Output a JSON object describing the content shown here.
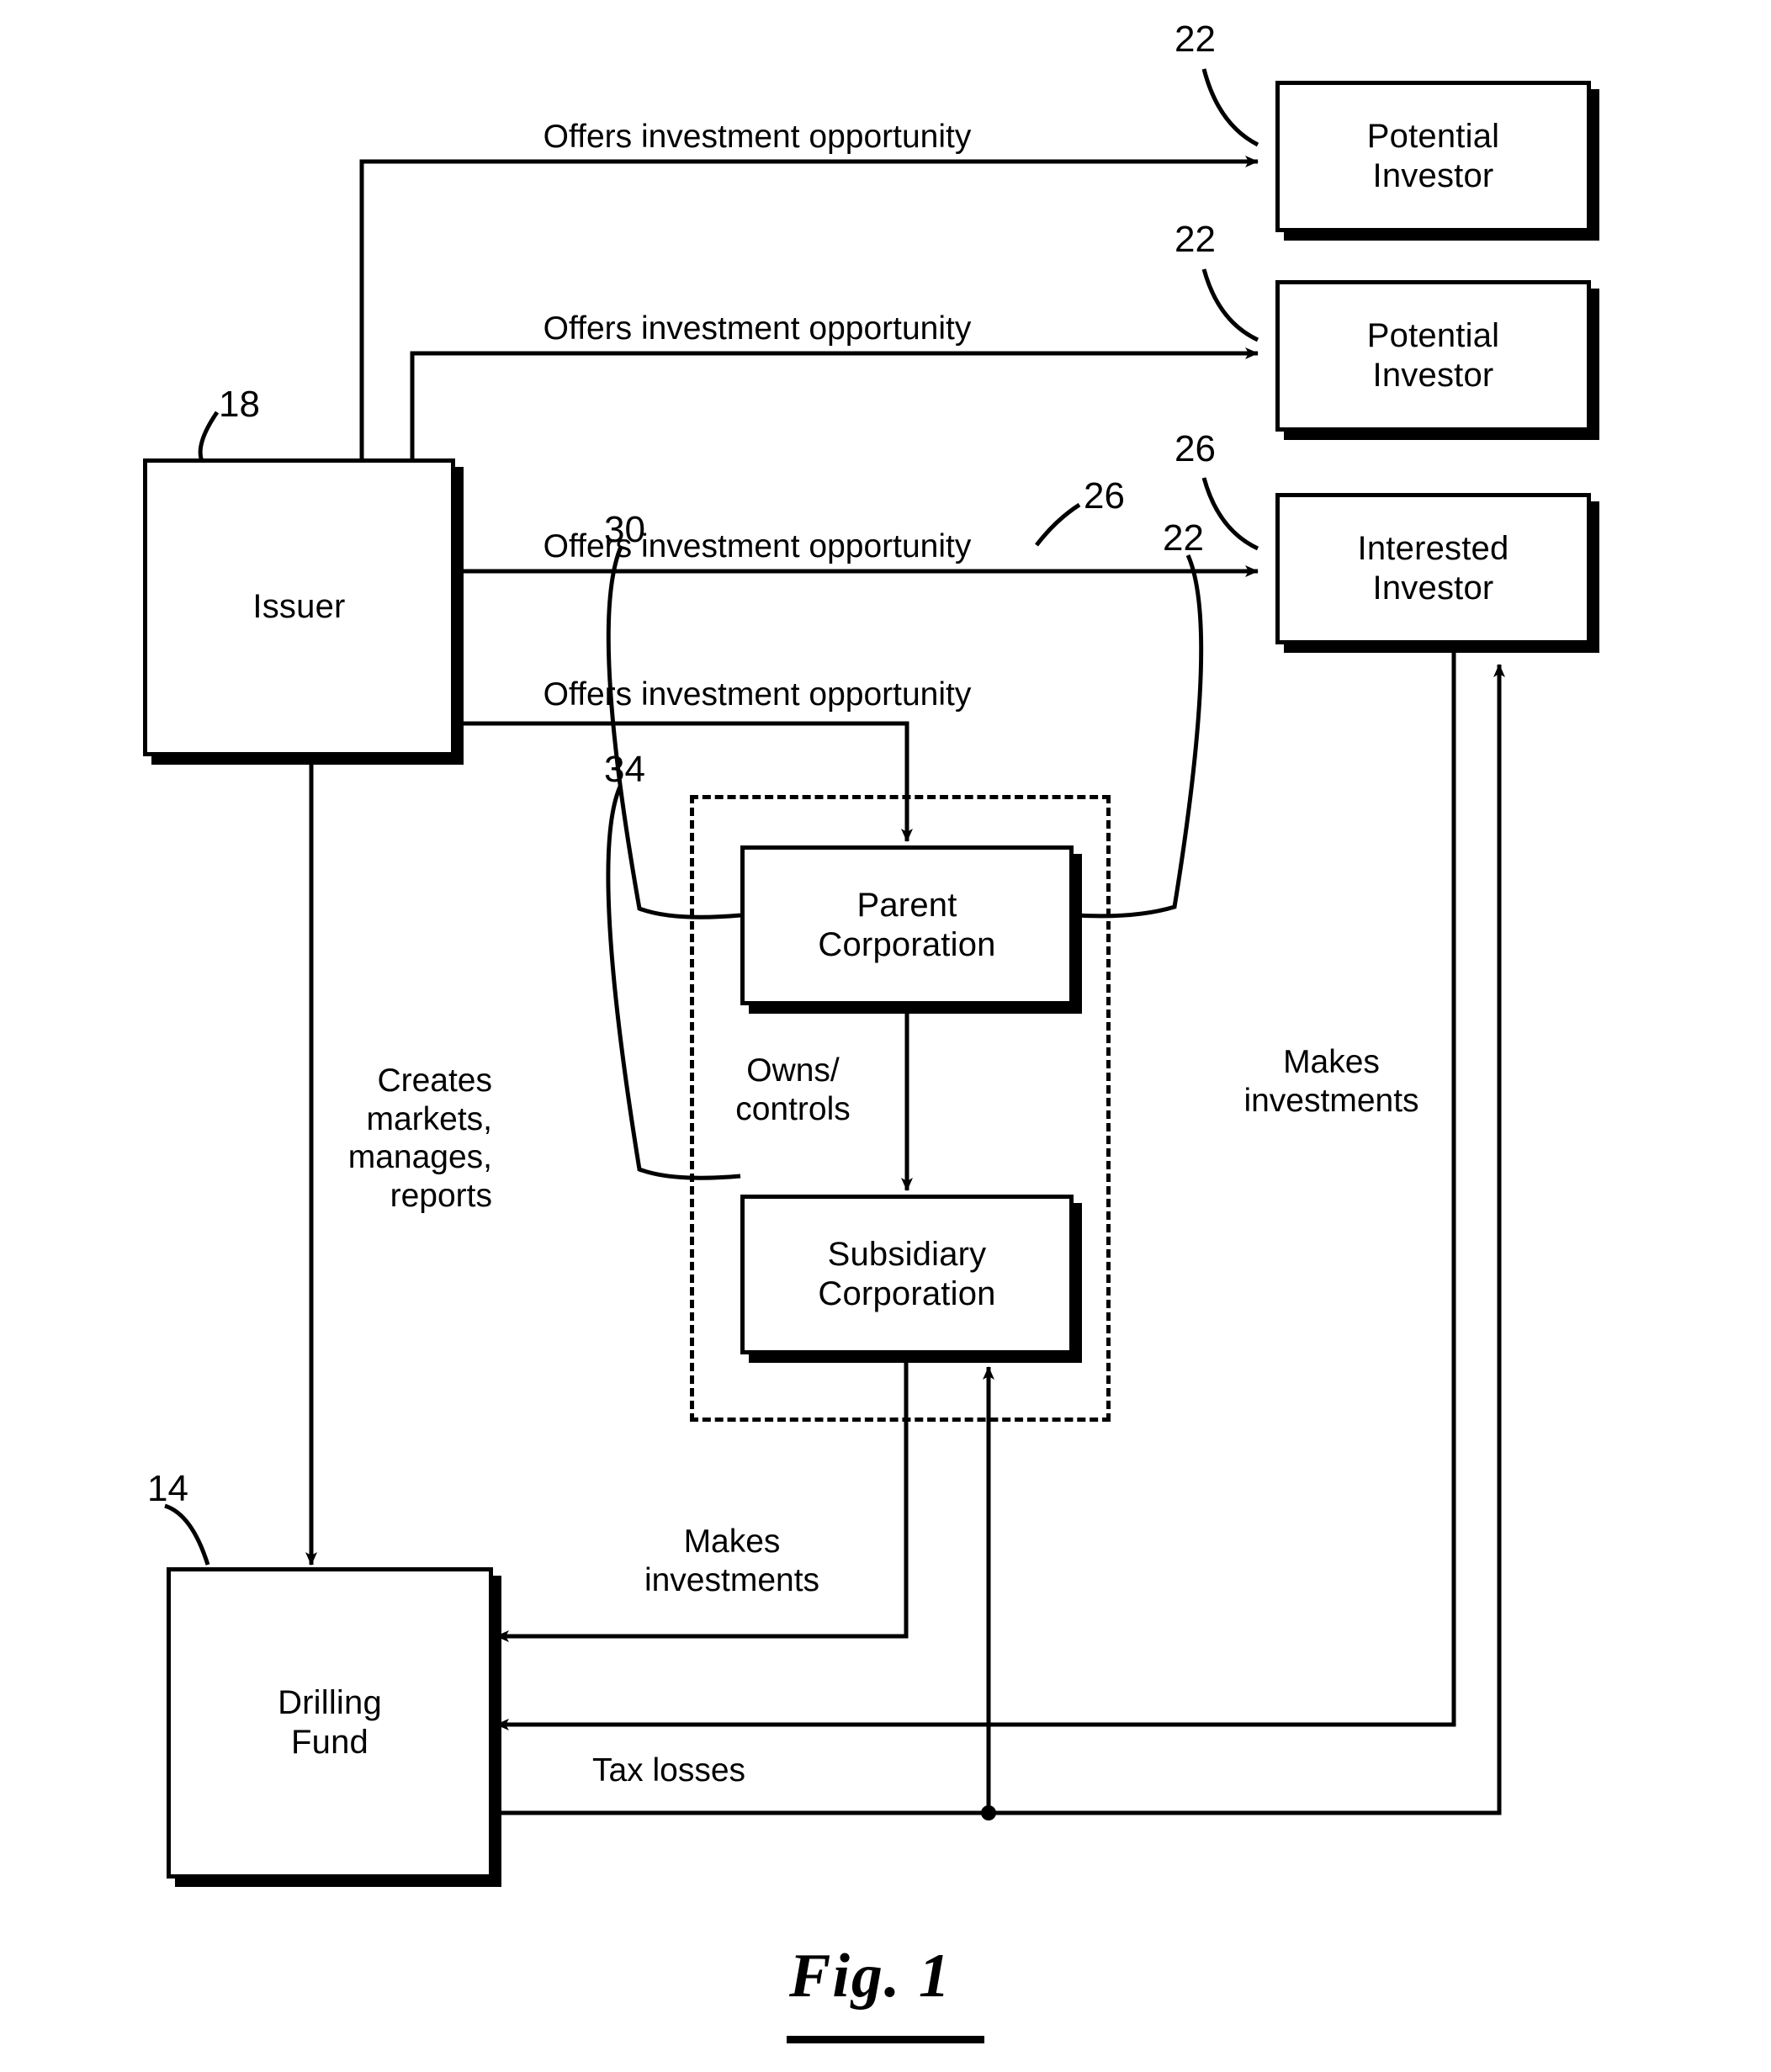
{
  "figure": {
    "caption": "Fig. 1",
    "type": "patent-flow-diagram"
  },
  "nodes": {
    "issuer": {
      "label": "Issuer",
      "ref": "18"
    },
    "potential_investor_1": {
      "label": "Potential\nInvestor",
      "ref": "22"
    },
    "potential_investor_2": {
      "label": "Potential\nInvestor",
      "ref": "22"
    },
    "interested_investor": {
      "label": "Interested\nInvestor",
      "ref": "26"
    },
    "parent_corporation": {
      "label": "Parent\nCorporation",
      "ref_left": "30",
      "ref_right": "22"
    },
    "subsidiary_corporation": {
      "label": "Subsidiary\nCorporation",
      "ref": "34"
    },
    "drilling_fund": {
      "label": "Drilling\nFund",
      "ref": "14"
    }
  },
  "group": {
    "label_ref": "26",
    "style": "dashed-boundary"
  },
  "edges": [
    {
      "id": "e1",
      "from": "issuer",
      "to": "potential_investor_1",
      "label": "Offers investment opportunity"
    },
    {
      "id": "e2",
      "from": "issuer",
      "to": "potential_investor_2",
      "label": "Offers investment opportunity"
    },
    {
      "id": "e3",
      "from": "issuer",
      "to": "interested_investor",
      "label": "Offers investment opportunity"
    },
    {
      "id": "e4",
      "from": "issuer",
      "to": "parent_corporation",
      "label": "Offers investment opportunity"
    },
    {
      "id": "e5",
      "from": "issuer",
      "to": "drilling_fund",
      "label": "Creates\nmarkets,\nmanages,\nreports"
    },
    {
      "id": "e6",
      "from": "parent_corporation",
      "to": "subsidiary_corporation",
      "label": "Owns/\ncontrols"
    },
    {
      "id": "e7",
      "from": "subsidiary_corporation",
      "to": "drilling_fund",
      "label": "Makes\ninvestments"
    },
    {
      "id": "e8",
      "from": "interested_investor",
      "to": "drilling_fund",
      "label": "Makes\ninvestments"
    },
    {
      "id": "e9",
      "from": "drilling_fund",
      "to": "interested_investor",
      "label": "Tax losses"
    }
  ],
  "labels": {
    "offers_1": "Offers investment opportunity",
    "offers_2": "Offers investment opportunity",
    "offers_3": "Offers investment opportunity",
    "offers_4": "Offers investment opportunity",
    "creates": "Creates\nmarkets,\nmanages,\nreports",
    "owns_controls": "Owns/\ncontrols",
    "makes_investments_sub": "Makes\ninvestments",
    "makes_investments_inv": "Makes\ninvestments",
    "tax_losses": "Tax losses"
  },
  "refs": {
    "r22_a": "22",
    "r22_b": "22",
    "r26_top": "26",
    "r18": "18",
    "r26_group": "26",
    "r30": "30",
    "r22_parent": "22",
    "r34": "34",
    "r14": "14"
  },
  "colors": {
    "ink": "#000000",
    "paper": "#ffffff"
  }
}
